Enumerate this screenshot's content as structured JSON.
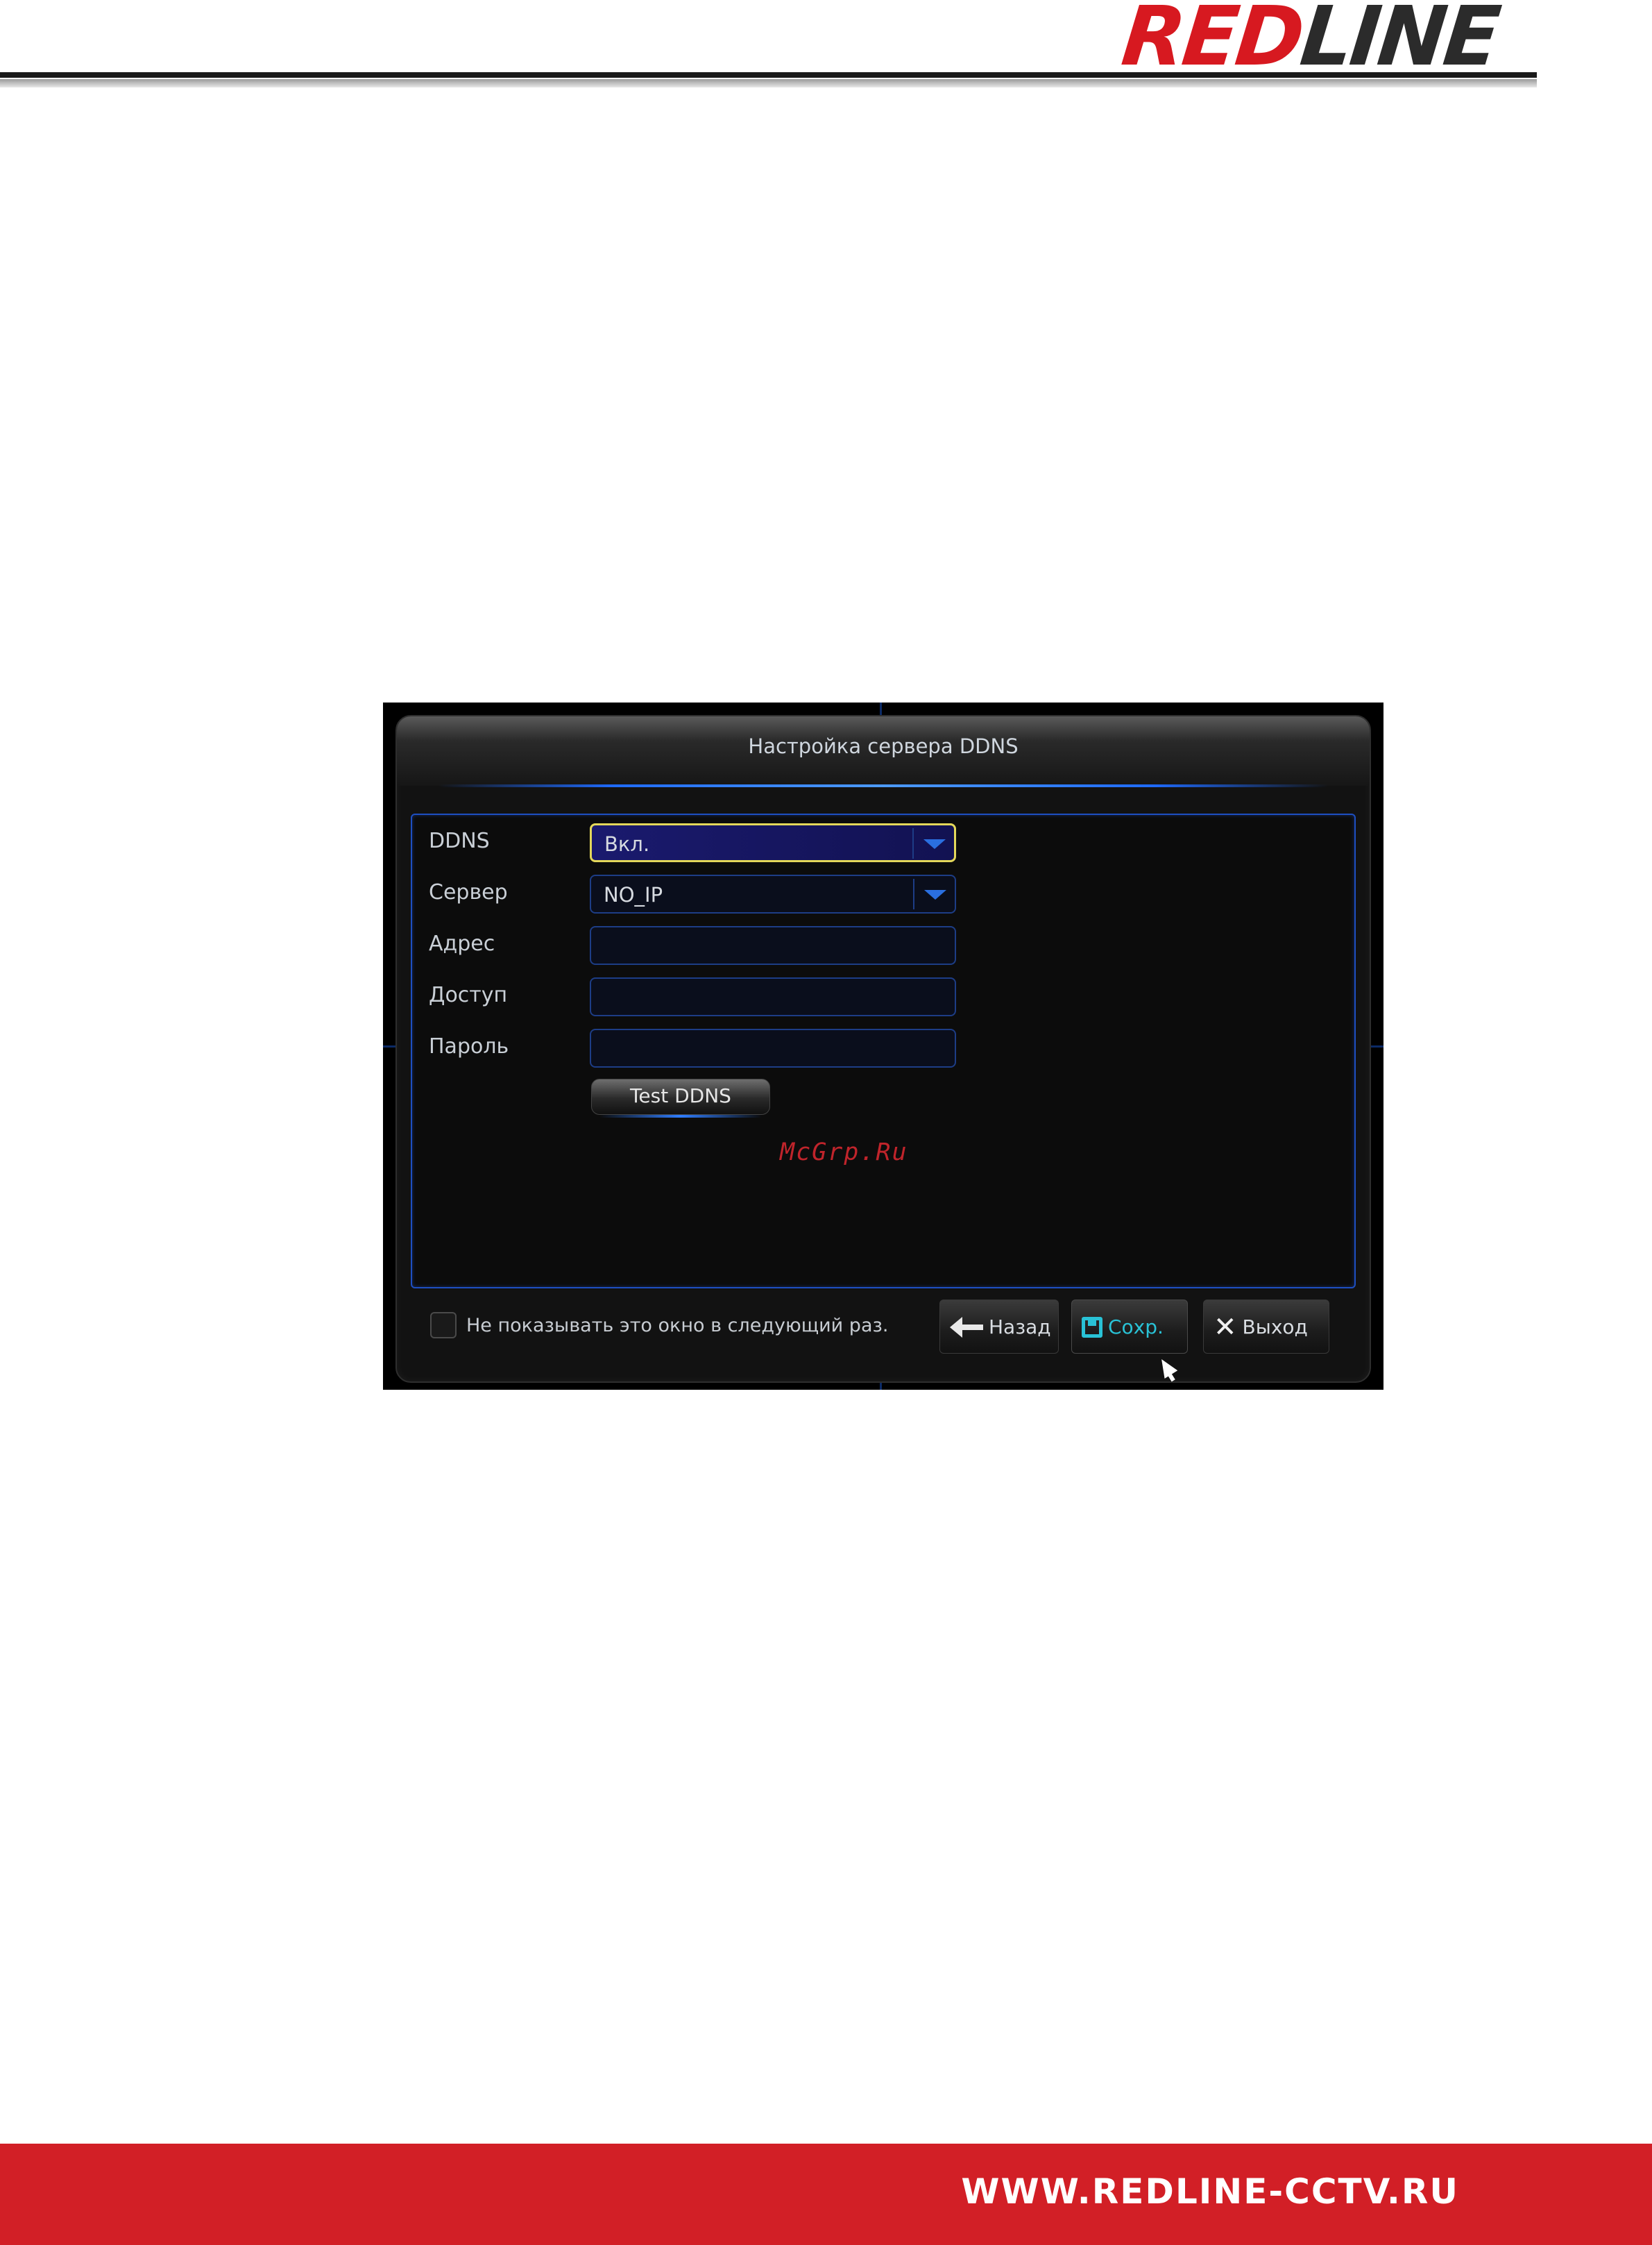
{
  "brand": {
    "part1": "RED",
    "part2": "LINE"
  },
  "dialog": {
    "title": "Настройка сервера DDNS",
    "rows": [
      {
        "label": "DDNS",
        "value": "Вкл.",
        "type": "dropdown"
      },
      {
        "label": "Сервер",
        "value": "NO_IP",
        "type": "dropdown"
      },
      {
        "label": "Адрес",
        "value": "",
        "type": "text"
      },
      {
        "label": "Доступ",
        "value": "",
        "type": "text"
      },
      {
        "label": "Пароль",
        "value": "",
        "type": "text"
      }
    ],
    "test_button": "Test DDNS",
    "dont_show_label": "Не показывать это окно в следующий раз.",
    "buttons": {
      "back": "Назад",
      "save": "Сохр.",
      "exit": "Выход"
    }
  },
  "watermark": "McGrp.Ru",
  "footer": {
    "url": "WWW.REDLINE-CCTV.RU"
  },
  "colors": {
    "brand_red": "#d21f26",
    "accent_blue": "#1d4fc2",
    "active_highlight": "#e4d85a",
    "save_teal": "#29c2d6"
  }
}
